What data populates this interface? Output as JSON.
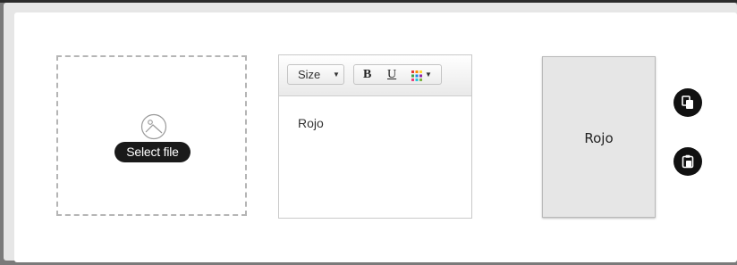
{
  "uploader": {
    "icon": "image-icon",
    "select_file_label": "Select file"
  },
  "editor": {
    "toolbar": {
      "size_label": "Size",
      "bold_label": "B",
      "underline_label": "U",
      "color_icon": "color-grid-icon"
    },
    "content": "Rojo"
  },
  "preview": {
    "text": "Rojo"
  },
  "actions": {
    "copy_icon": "copy-icon",
    "paste_icon": "paste-icon"
  },
  "colors": {
    "accent_dark": "#111111",
    "panel_bg": "#e6e6e6",
    "card_bg": "#ffffff"
  }
}
